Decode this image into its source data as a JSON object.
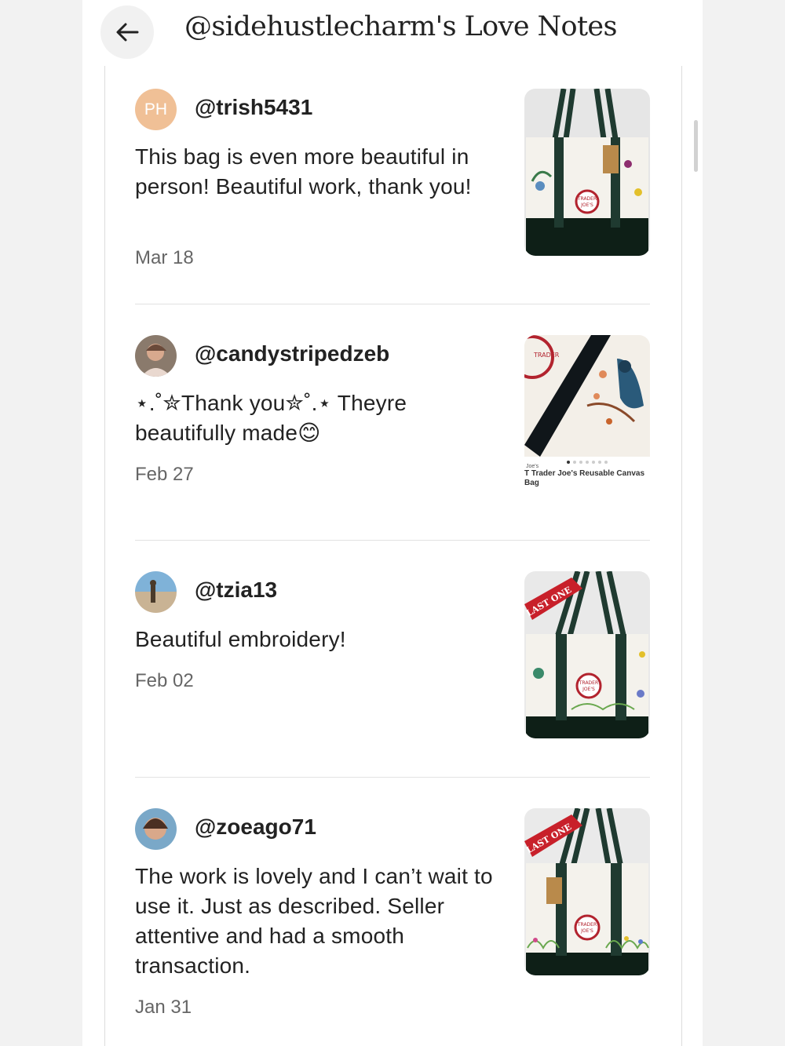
{
  "header": {
    "title": "@sidehustlecharm's Love Notes",
    "back_icon": "arrow-left-icon"
  },
  "reviews": [
    {
      "avatar_initials": "PH",
      "username": "@trish5431",
      "text": "This bag is even more beautiful in person! Beautiful work, thank you!",
      "date": "Mar 18",
      "thumb_labels": [
        "TRADER",
        "JOE'S"
      ]
    },
    {
      "username": "@candystripedzeb",
      "text": "⋆.˚✮Thank you✮˚.⋆ Theyre beautifully made😊",
      "date": "Feb 27",
      "thumb_caption_small": "Joe's",
      "thumb_caption": "T Trader Joe's Reusable Canvas Bag",
      "thumb_stamp": "TRADER"
    },
    {
      "username": "@tzia13",
      "text": "Beautiful embroidery!",
      "date": "Feb 02",
      "thumb_tag": "LAST ONE",
      "thumb_labels": [
        "TRADER",
        "JOE'S"
      ]
    },
    {
      "username": "@zoeago71",
      "text": "The work is lovely and I can’t wait to use it. Just as described. Seller attentive and had a smooth transaction.",
      "date": "Jan 31",
      "thumb_tag": "LAST ONE",
      "thumb_labels": [
        "TRADER",
        "JOE'S"
      ]
    }
  ]
}
